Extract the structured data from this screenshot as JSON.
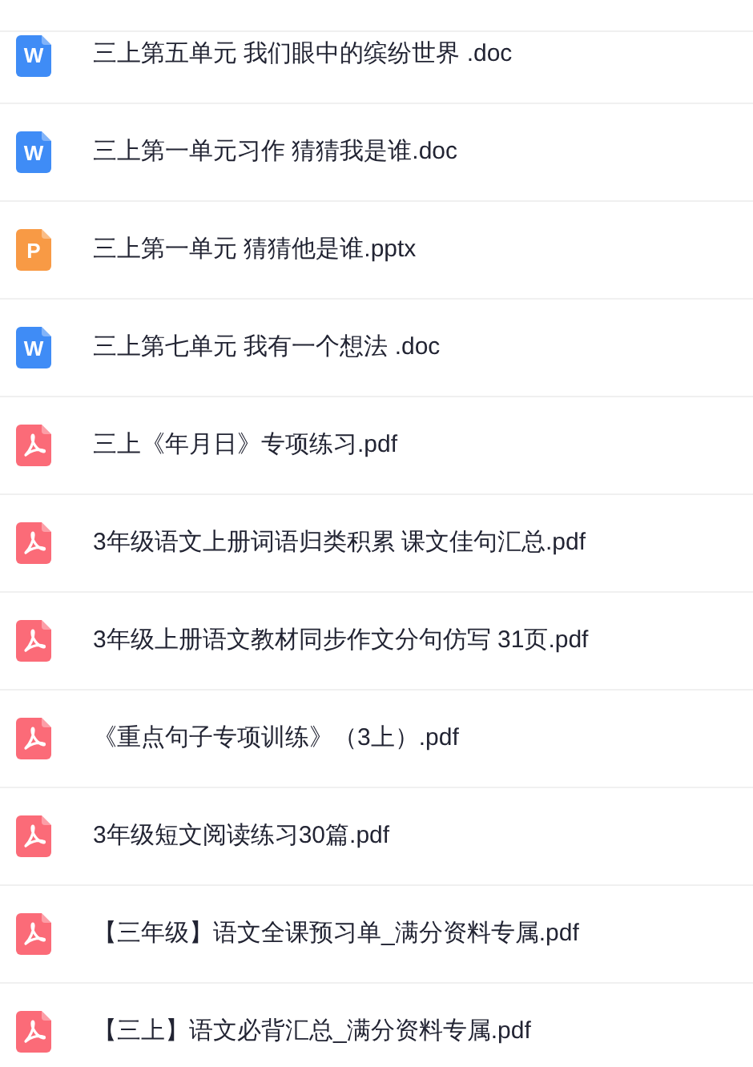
{
  "files": [
    {
      "kind": "doc",
      "icon_text": "W",
      "name": "三上第五单元 我们眼中的缤纷世界 .doc"
    },
    {
      "kind": "doc",
      "icon_text": "W",
      "name": "三上第一单元习作 猜猜我是谁.doc"
    },
    {
      "kind": "ppt",
      "icon_text": "P",
      "name": "三上第一单元 猜猜他是谁.pptx"
    },
    {
      "kind": "doc",
      "icon_text": "W",
      "name": "三上第七单元 我有一个想法 .doc"
    },
    {
      "kind": "pdf",
      "name": "三上《年月日》专项练习.pdf"
    },
    {
      "kind": "pdf",
      "name": "3年级语文上册词语归类积累 课文佳句汇总.pdf"
    },
    {
      "kind": "pdf",
      "name": "3年级上册语文教材同步作文分句仿写 31页.pdf"
    },
    {
      "kind": "pdf",
      "name": "《重点句子专项训练》（3上）.pdf"
    },
    {
      "kind": "pdf",
      "name": "3年级短文阅读练习30篇.pdf"
    },
    {
      "kind": "pdf",
      "name": "【三年级】语文全课预习单_满分资料专属.pdf"
    },
    {
      "kind": "pdf",
      "name": "【三上】语文必背汇总_满分资料专属.pdf"
    }
  ]
}
